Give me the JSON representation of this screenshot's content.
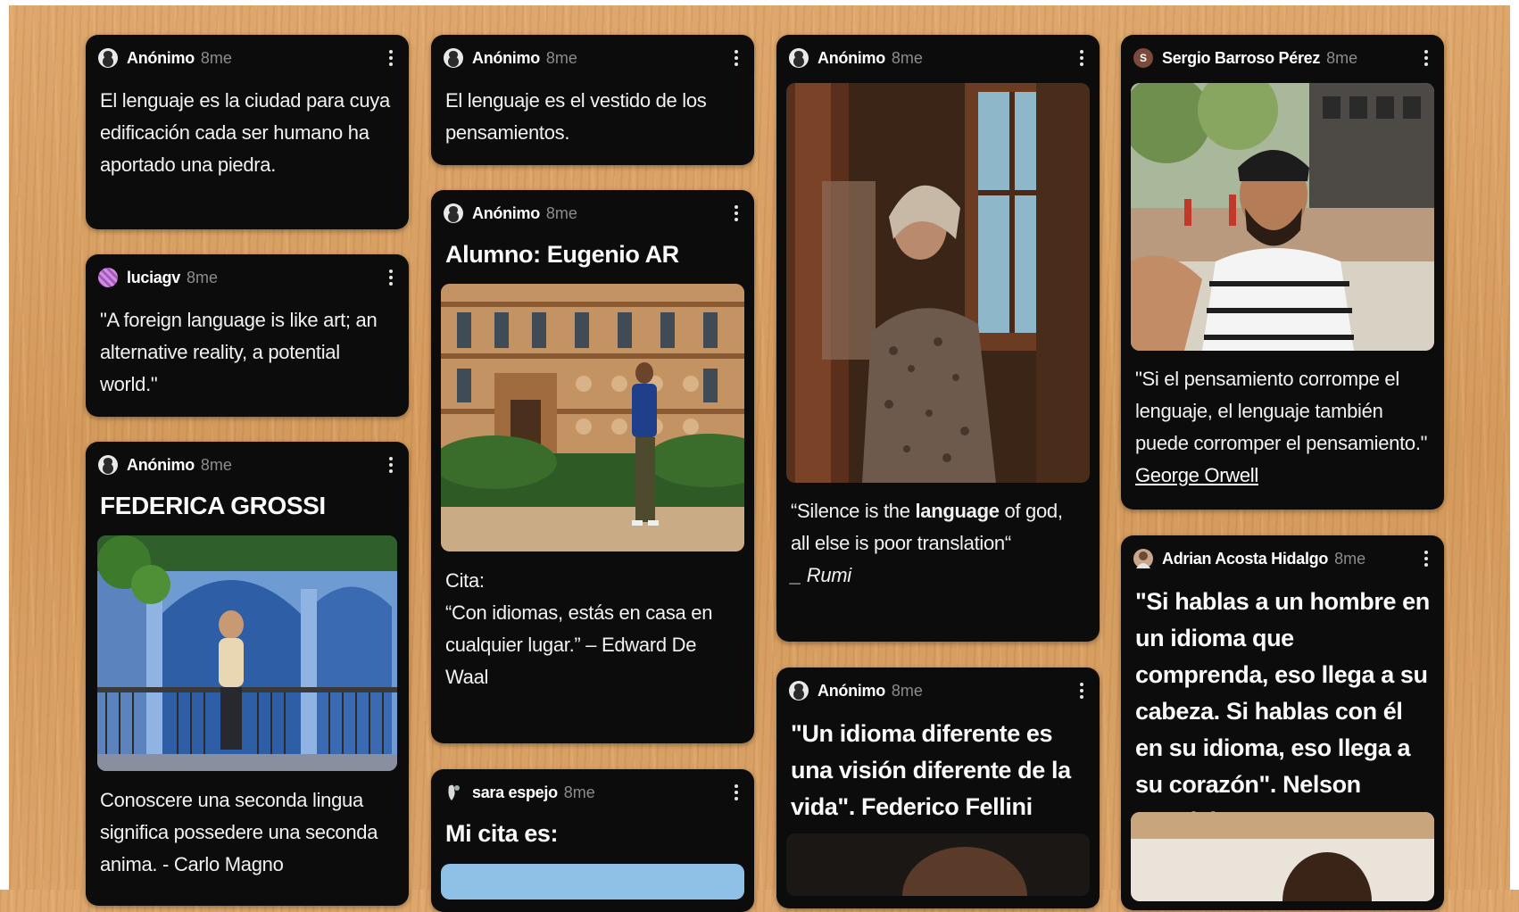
{
  "posts": {
    "p1": {
      "author": "Anónimo",
      "time": "8me",
      "text": "El lenguaje es la ciudad para cuya edificación cada ser humano ha aportado una piedra."
    },
    "p2": {
      "author": "luciagv",
      "time": "8me",
      "text": "\"A foreign language is like art; an alternative reality, a potential world.\""
    },
    "p3": {
      "author": "Anónimo",
      "time": "8me",
      "title": "FEDERICA GROSSI",
      "text": "Conoscere una seconda lingua significa possedere una seconda anima. - Carlo Magno"
    },
    "p4": {
      "author": "Anónimo",
      "time": "8me",
      "text": "El lenguaje es el vestido de los pensamientos."
    },
    "p5": {
      "author": "Anónimo",
      "time": "8me",
      "title": "Alumno: Eugenio AR",
      "text_label": "Cita:",
      "text": "“Con idiomas, estás en casa en cualquier lugar.” – Edward De Waal"
    },
    "p6": {
      "author": "sara espejo",
      "time": "8me",
      "title": "Mi cita es:"
    },
    "p7": {
      "author": "Anónimo",
      "time": "8me",
      "quote_pre": "“Silence is the ",
      "quote_bold": "language",
      "quote_post": " of god, all else is poor translation“",
      "attribution": "_ Rumi"
    },
    "p8": {
      "author": "Anónimo",
      "time": "8me",
      "text": "\"Un idioma diferente es una visión diferente de la vida\". Federico Fellini"
    },
    "p9": {
      "author": "Sergio Barroso Pérez",
      "time": "8me",
      "avatar_letter": "S",
      "text": "\"Si el pensamiento corrompe el lenguaje, el lenguaje también puede corromper el pensamiento.\"",
      "link_text": "George Orwell"
    },
    "p10": {
      "author": "Adrian Acosta Hidalgo",
      "time": "8me",
      "text": "\"Si hablas a un hombre en un idioma que comprenda, eso llega a su cabeza. Si hablas con él en su idioma, eso llega a su corazón\". Nelson Mandela"
    }
  },
  "icons": {
    "menu": "more-vertical-icon",
    "anon": "anonymous-avatar-icon"
  },
  "colors": {
    "card": "#0c0c0c",
    "background": "#d9a066",
    "muted": "#8c8c8c"
  }
}
